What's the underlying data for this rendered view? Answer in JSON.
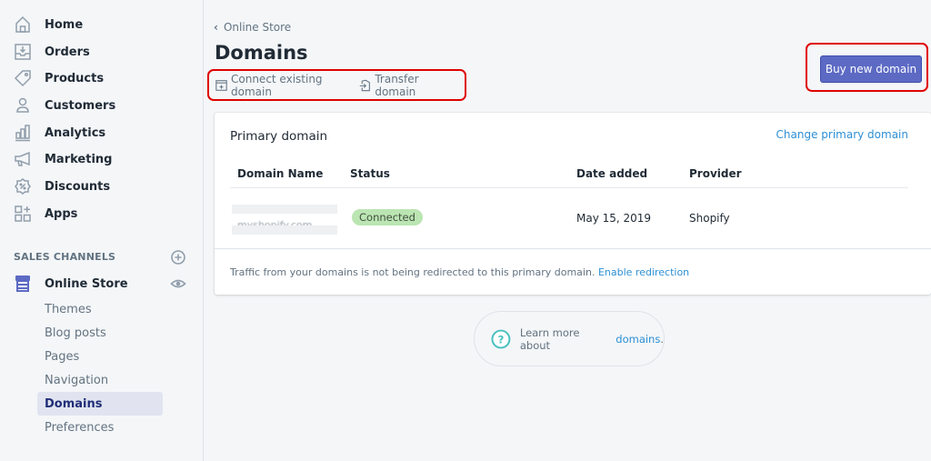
{
  "sidebar": {
    "items": [
      {
        "label": "Home",
        "icon": "home-icon"
      },
      {
        "label": "Orders",
        "icon": "orders-icon"
      },
      {
        "label": "Products",
        "icon": "tag-icon"
      },
      {
        "label": "Customers",
        "icon": "person-icon"
      },
      {
        "label": "Analytics",
        "icon": "bar-chart-icon"
      },
      {
        "label": "Marketing",
        "icon": "megaphone-icon"
      },
      {
        "label": "Discounts",
        "icon": "discount-icon"
      },
      {
        "label": "Apps",
        "icon": "apps-icon"
      }
    ],
    "sales_channels_label": "SALES CHANNELS",
    "online_store": {
      "label": "Online Store",
      "sub_items": [
        {
          "label": "Themes",
          "active": false
        },
        {
          "label": "Blog posts",
          "active": false
        },
        {
          "label": "Pages",
          "active": false
        },
        {
          "label": "Navigation",
          "active": false
        },
        {
          "label": "Domains",
          "active": true
        },
        {
          "label": "Preferences",
          "active": false
        }
      ]
    }
  },
  "header": {
    "breadcrumb": "Online Store",
    "title": "Domains",
    "actions": {
      "connect": "Connect existing domain",
      "transfer": "Transfer domain"
    },
    "buy_button": "Buy new domain"
  },
  "primary_domain": {
    "title": "Primary domain",
    "change_link": "Change primary domain",
    "columns": [
      "Domain Name",
      "Status",
      "Date added",
      "Provider"
    ],
    "rows": [
      {
        "domain_name": "myshopify.com",
        "status": "Connected",
        "date_added": "May 15, 2019",
        "provider": "Shopify"
      }
    ],
    "footer_text": "Traffic from your domains is not being redirected to this primary domain.",
    "footer_link": "Enable redirection"
  },
  "help": {
    "text": "Learn more about",
    "link": "domains",
    "suffix": "."
  },
  "colors": {
    "accent": "#5c6ac4",
    "link": "#2d8fd5",
    "success_badge": "#bbe5b3",
    "highlight_outline": "#e00000"
  }
}
